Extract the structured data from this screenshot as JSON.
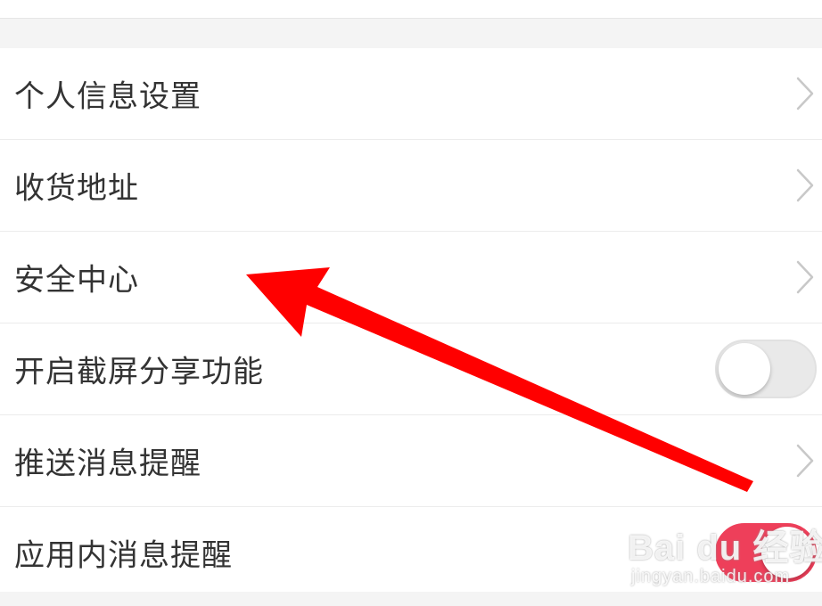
{
  "settings": {
    "items": [
      {
        "label": "个人信息设置",
        "control": "chevron"
      },
      {
        "label": "收货地址",
        "control": "chevron"
      },
      {
        "label": "安全中心",
        "control": "chevron"
      },
      {
        "label": "开启截屏分享功能",
        "control": "toggle",
        "state": "off"
      },
      {
        "label": "推送消息提醒",
        "control": "chevron"
      },
      {
        "label": "应用内消息提醒",
        "control": "toggle",
        "state": "on"
      }
    ]
  },
  "watermark": {
    "brand": "Bai du 经验",
    "url": "jingyan.baidu.com"
  },
  "colors": {
    "accent": "#ee3f5a",
    "annotation_arrow": "#ff0000",
    "text": "#333333",
    "chevron": "#c8c8c8"
  },
  "icons": {
    "chevron": "chevron-right-icon",
    "annotation": "red-arrow-icon"
  }
}
